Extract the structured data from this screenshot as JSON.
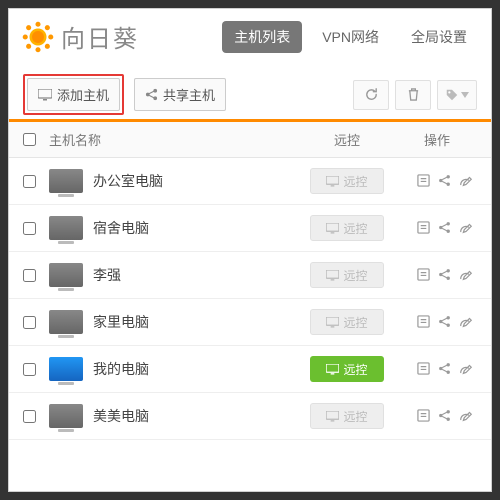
{
  "app_name": "向日葵",
  "nav": {
    "hosts": "主机列表",
    "vpn": "VPN网络",
    "settings": "全局设置"
  },
  "toolbar": {
    "add_host": "添加主机",
    "share_host": "共享主机"
  },
  "columns": {
    "name": "主机名称",
    "remote": "远控",
    "actions": "操作"
  },
  "remote_label": "远控",
  "hosts": [
    {
      "name": "办公室电脑",
      "online": false
    },
    {
      "name": "宿舍电脑",
      "online": false
    },
    {
      "name": "李强",
      "online": false
    },
    {
      "name": "家里电脑",
      "online": false
    },
    {
      "name": "我的电脑",
      "online": true
    },
    {
      "name": "美美电脑",
      "online": false
    }
  ]
}
